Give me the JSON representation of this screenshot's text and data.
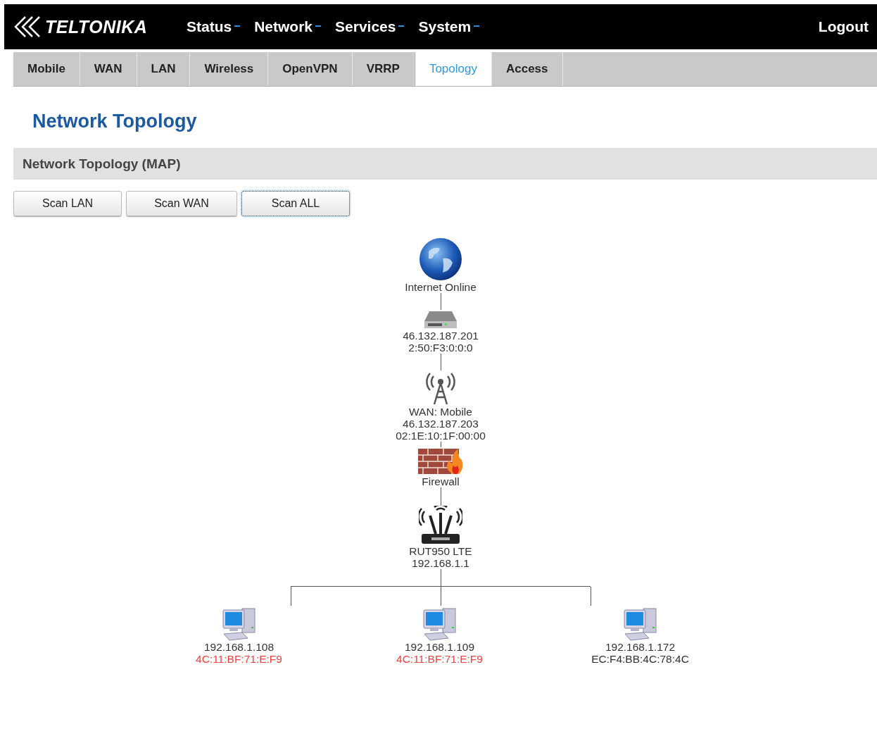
{
  "header": {
    "logo": "TELTONIKA",
    "menu": [
      {
        "label": "Status"
      },
      {
        "label": "Network"
      },
      {
        "label": "Services"
      },
      {
        "label": "System"
      }
    ],
    "logout": "Logout"
  },
  "tabs": [
    {
      "label": "Mobile",
      "selected": false
    },
    {
      "label": "WAN",
      "selected": false
    },
    {
      "label": "LAN",
      "selected": false
    },
    {
      "label": "Wireless",
      "selected": false
    },
    {
      "label": "OpenVPN",
      "selected": false
    },
    {
      "label": "VRRP",
      "selected": false
    },
    {
      "label": "Topology",
      "selected": true
    },
    {
      "label": "Access",
      "selected": false
    }
  ],
  "page_title": "Network Topology",
  "section_title": "Network Topology (MAP)",
  "buttons": [
    {
      "label": "Scan LAN",
      "selected": false
    },
    {
      "label": "Scan WAN",
      "selected": false
    },
    {
      "label": "Scan ALL",
      "selected": true
    }
  ],
  "topology": {
    "chain": [
      {
        "kind": "globe",
        "lines": [
          "Internet Online"
        ]
      },
      {
        "kind": "switch",
        "lines": [
          "46.132.187.201",
          "2:50:F3:0:0:0"
        ]
      },
      {
        "kind": "tower",
        "lines": [
          "WAN: Mobile",
          "46.132.187.203",
          "02:1E:10:1F:00:00"
        ]
      },
      {
        "kind": "firewall",
        "lines": [
          "Firewall"
        ]
      },
      {
        "kind": "router",
        "lines": [
          "RUT950 LTE",
          "192.168.1.1"
        ]
      }
    ],
    "clients": [
      {
        "ip": "192.168.1.108",
        "mac": "4C:11:BF:71:E:F9",
        "warning": true
      },
      {
        "ip": "192.168.1.109",
        "mac": "4C:11:BF:71:E:F9",
        "warning": true
      },
      {
        "ip": "192.168.1.172",
        "mac": "EC:F4:BB:4C:78:4C",
        "warning": false
      }
    ]
  }
}
